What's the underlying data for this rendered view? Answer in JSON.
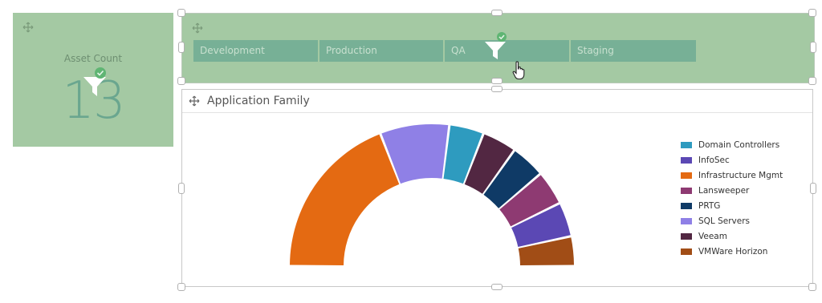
{
  "asset_tile": {
    "title": "Asset Count",
    "value": "13"
  },
  "filter_tile": {
    "environments": [
      {
        "label": "Development"
      },
      {
        "label": "Production"
      },
      {
        "label": "QA"
      },
      {
        "label": "Staging"
      }
    ]
  },
  "chart_tile": {
    "title": "Application Family"
  },
  "chart_data": {
    "type": "pie",
    "variant": "semi-donut",
    "title": "Application Family",
    "legend_position": "right",
    "slices": [
      {
        "name": "Infrastructure Mgmt",
        "value": 34,
        "color": "#e46a12"
      },
      {
        "name": "SQL Servers",
        "value": 14,
        "color": "#8f80e6"
      },
      {
        "name": "Domain Controllers",
        "value": 7,
        "color": "#2e9bbf"
      },
      {
        "name": "Veeam",
        "value": 7,
        "color": "#522742"
      },
      {
        "name": "PRTG",
        "value": 7,
        "color": "#0f3a66"
      },
      {
        "name": "Lansweeper",
        "value": 7,
        "color": "#8e3a72"
      },
      {
        "name": "InfoSec",
        "value": 7,
        "color": "#5b48b4"
      },
      {
        "name": "VMWare Horizon",
        "value": 6,
        "color": "#a14d16"
      }
    ],
    "legend": [
      {
        "name": "Domain Controllers",
        "color": "#2e9bbf"
      },
      {
        "name": "InfoSec",
        "color": "#5b48b4"
      },
      {
        "name": "Infrastructure Mgmt",
        "color": "#e46a12"
      },
      {
        "name": "Lansweeper",
        "color": "#8e3a72"
      },
      {
        "name": "PRTG",
        "color": "#0f3a66"
      },
      {
        "name": "SQL Servers",
        "color": "#8f80e6"
      },
      {
        "name": "Veeam",
        "color": "#522742"
      },
      {
        "name": "VMWare Horizon",
        "color": "#a14d16"
      }
    ]
  },
  "icons": {
    "move": "move-icon",
    "filter": "filter-icon",
    "check": "check-badge-icon",
    "cursor": "hand-pointer-icon"
  },
  "colors": {
    "tile_green": "#a4c9a3",
    "button_green": "#77b096",
    "badge_green": "#5fb573"
  }
}
